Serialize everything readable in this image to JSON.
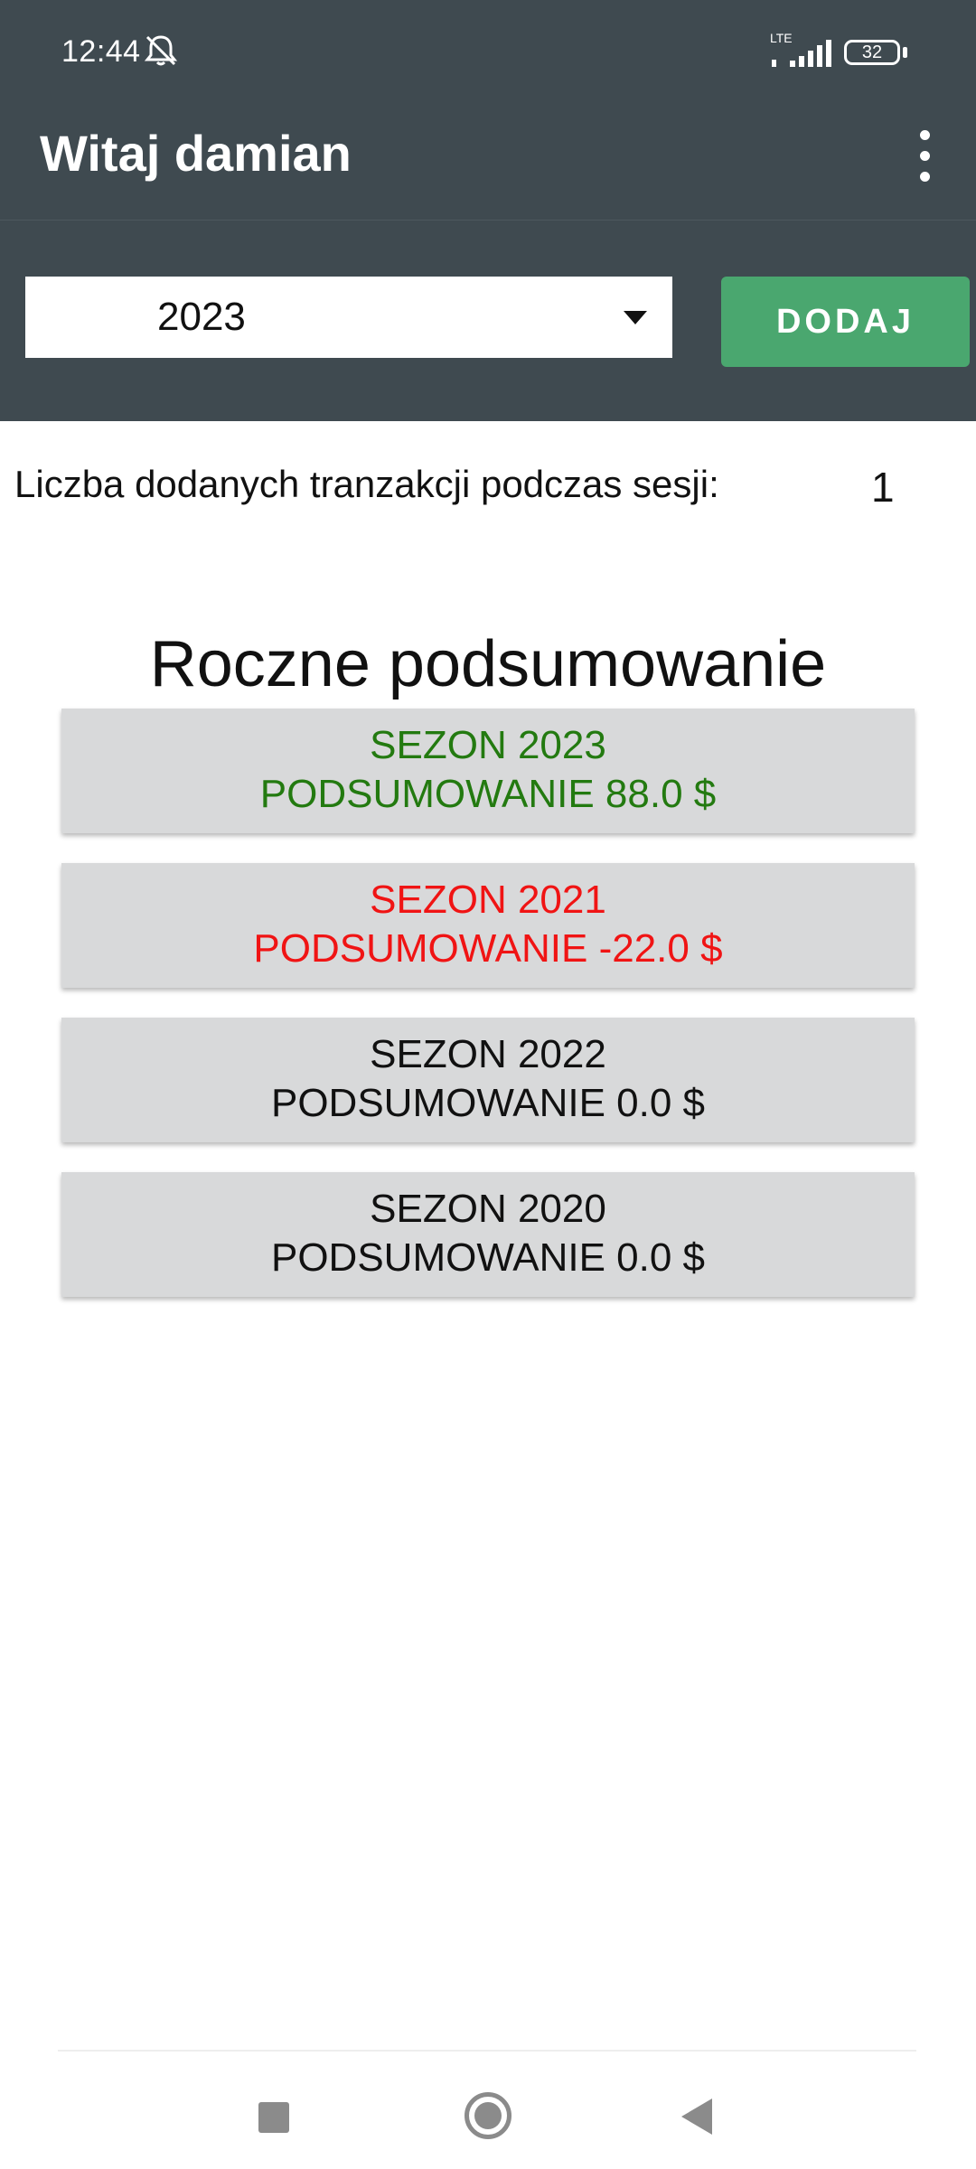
{
  "status_bar": {
    "time": "12:44",
    "network": "LTE",
    "battery": "32",
    "icons": [
      "bell-off-icon",
      "signal-icon",
      "battery-icon"
    ]
  },
  "app_bar": {
    "title": "Witaj damian",
    "menu_icon": "overflow-menu-icon"
  },
  "controls": {
    "selected_year": "2023",
    "add_button_label": "DODAJ"
  },
  "session": {
    "label": "Liczba dodanych tranzakcji podczas sesji:",
    "count": "1"
  },
  "summary": {
    "title": "Roczne podsumowanie",
    "seasons": [
      {
        "season": "SEZON 2023",
        "summary": "PODSUMOWANIE 88.0 $",
        "color": "#237a10"
      },
      {
        "season": "SEZON 2021",
        "summary": "PODSUMOWANIE -22.0 $",
        "color": "#f01414"
      },
      {
        "season": "SEZON 2022",
        "summary": "PODSUMOWANIE 0.0 $",
        "color": "#111111"
      },
      {
        "season": "SEZON 2020",
        "summary": "PODSUMOWANIE 0.0 $",
        "color": "#111111"
      }
    ]
  },
  "colors": {
    "header": "#3f4a50",
    "accent": "#4aa76f",
    "card": "#d8d9da",
    "positive": "#237a10",
    "negative": "#f01414"
  },
  "navigation_icons": [
    "recents-icon",
    "home-icon",
    "back-icon"
  ]
}
